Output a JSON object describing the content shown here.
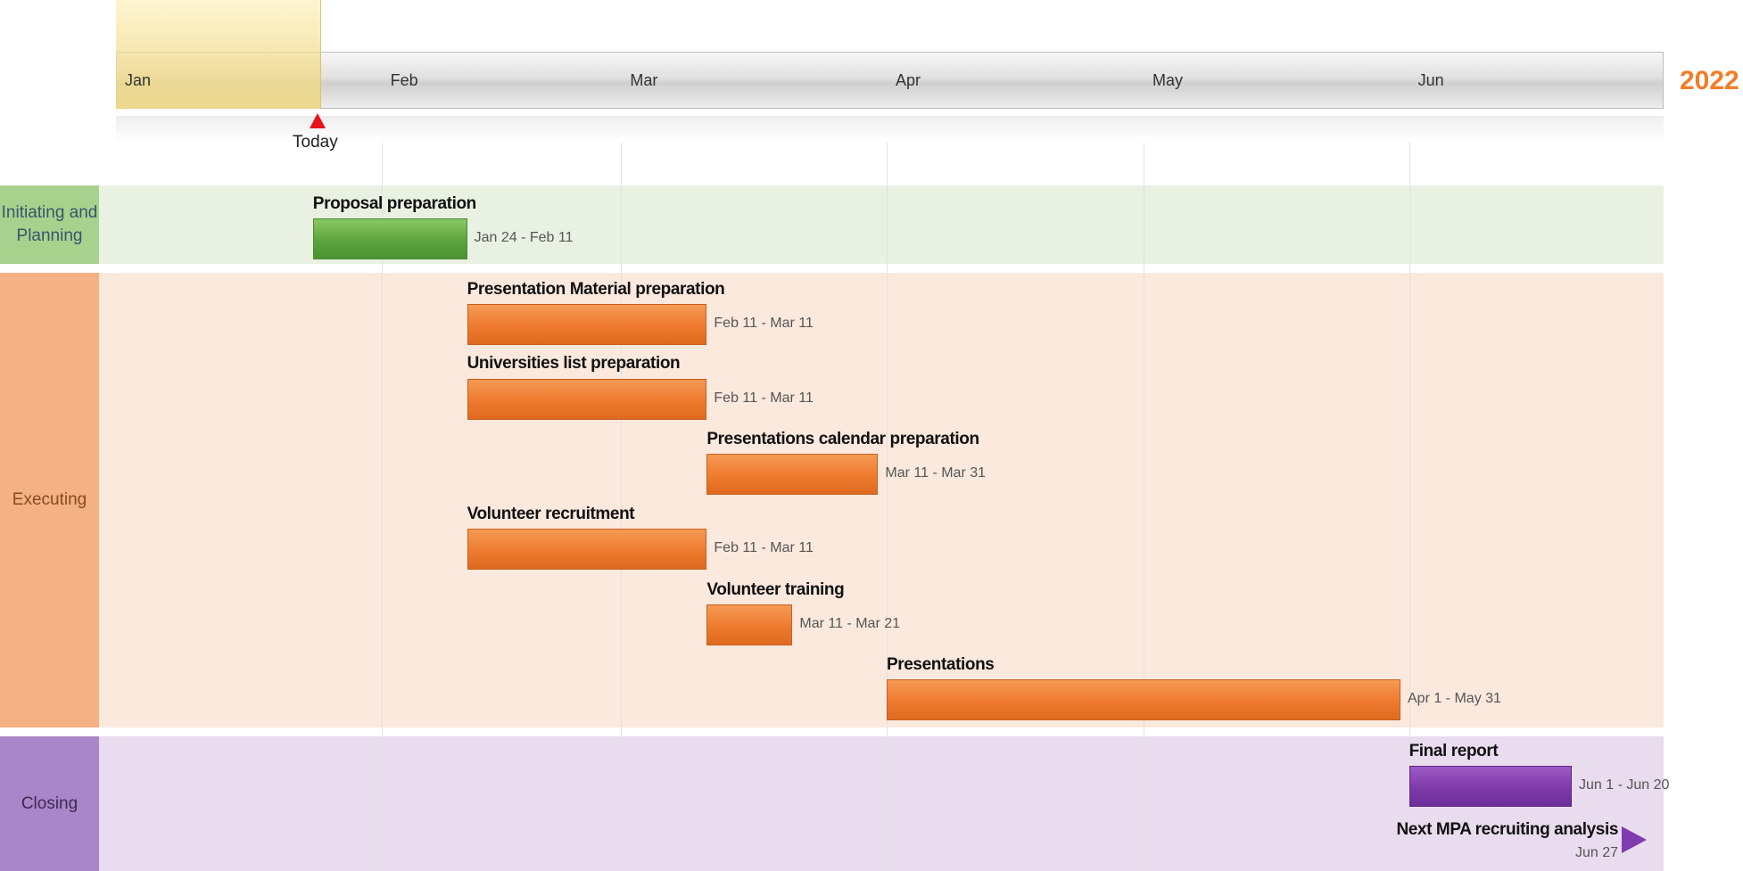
{
  "chart_data": {
    "type": "gantt",
    "year": "2022",
    "months": [
      "Jan",
      "Feb",
      "Mar",
      "Apr",
      "May",
      "Jun"
    ],
    "today": {
      "label": "Today",
      "date": "2022-01-24"
    },
    "phases": [
      {
        "name": "Initiating and Planning",
        "color": "#e9f1e3",
        "label_bg": "#a9d18e",
        "label_color": "#35566b"
      },
      {
        "name": "Executing",
        "color": "#fbe9dd",
        "label_bg": "#f4b183",
        "label_color": "#8a4a1e"
      },
      {
        "name": "Closing",
        "color": "#e9dcef",
        "label_bg": "#a985c9",
        "label_color": "#3c2a52"
      }
    ],
    "tasks": [
      {
        "name": "Proposal preparation",
        "dates": "Jan 24 - Feb 11",
        "start": "2022-01-24",
        "end": "2022-02-11",
        "phase": "Initiating and Planning",
        "color": "#5aa33d"
      },
      {
        "name": "Presentation Material preparation",
        "dates": "Feb 11 - Mar 11",
        "start": "2022-02-11",
        "end": "2022-03-11",
        "phase": "Executing",
        "color": "#ee7a2e"
      },
      {
        "name": "Universities list preparation",
        "dates": "Feb 11 - Mar 11",
        "start": "2022-02-11",
        "end": "2022-03-11",
        "phase": "Executing",
        "color": "#ee7a2e"
      },
      {
        "name": "Presentations calendar preparation",
        "dates": "Mar 11 - Mar 31",
        "start": "2022-03-11",
        "end": "2022-03-31",
        "phase": "Executing",
        "color": "#ee7a2e"
      },
      {
        "name": "Volunteer recruitment",
        "dates": "Feb 11 - Mar 11",
        "start": "2022-02-11",
        "end": "2022-03-11",
        "phase": "Executing",
        "color": "#ee7a2e"
      },
      {
        "name": "Volunteer training",
        "dates": "Mar 11 - Mar 21",
        "start": "2022-03-11",
        "end": "2022-03-21",
        "phase": "Executing",
        "color": "#ee7a2e"
      },
      {
        "name": "Presentations",
        "dates": "Apr 1 - May 31",
        "start": "2022-04-01",
        "end": "2022-05-31",
        "phase": "Executing",
        "color": "#ee7a2e"
      },
      {
        "name": "Final report",
        "dates": "Jun 1 - Jun 20",
        "start": "2022-06-01",
        "end": "2022-06-20",
        "phase": "Closing",
        "color": "#7d3aa8"
      }
    ],
    "milestones": [
      {
        "name": "Next MPA recruiting analysis",
        "date_label": "Jun 27",
        "date": "2022-06-27",
        "phase": "Closing",
        "color": "#7e3cb0"
      }
    ]
  }
}
